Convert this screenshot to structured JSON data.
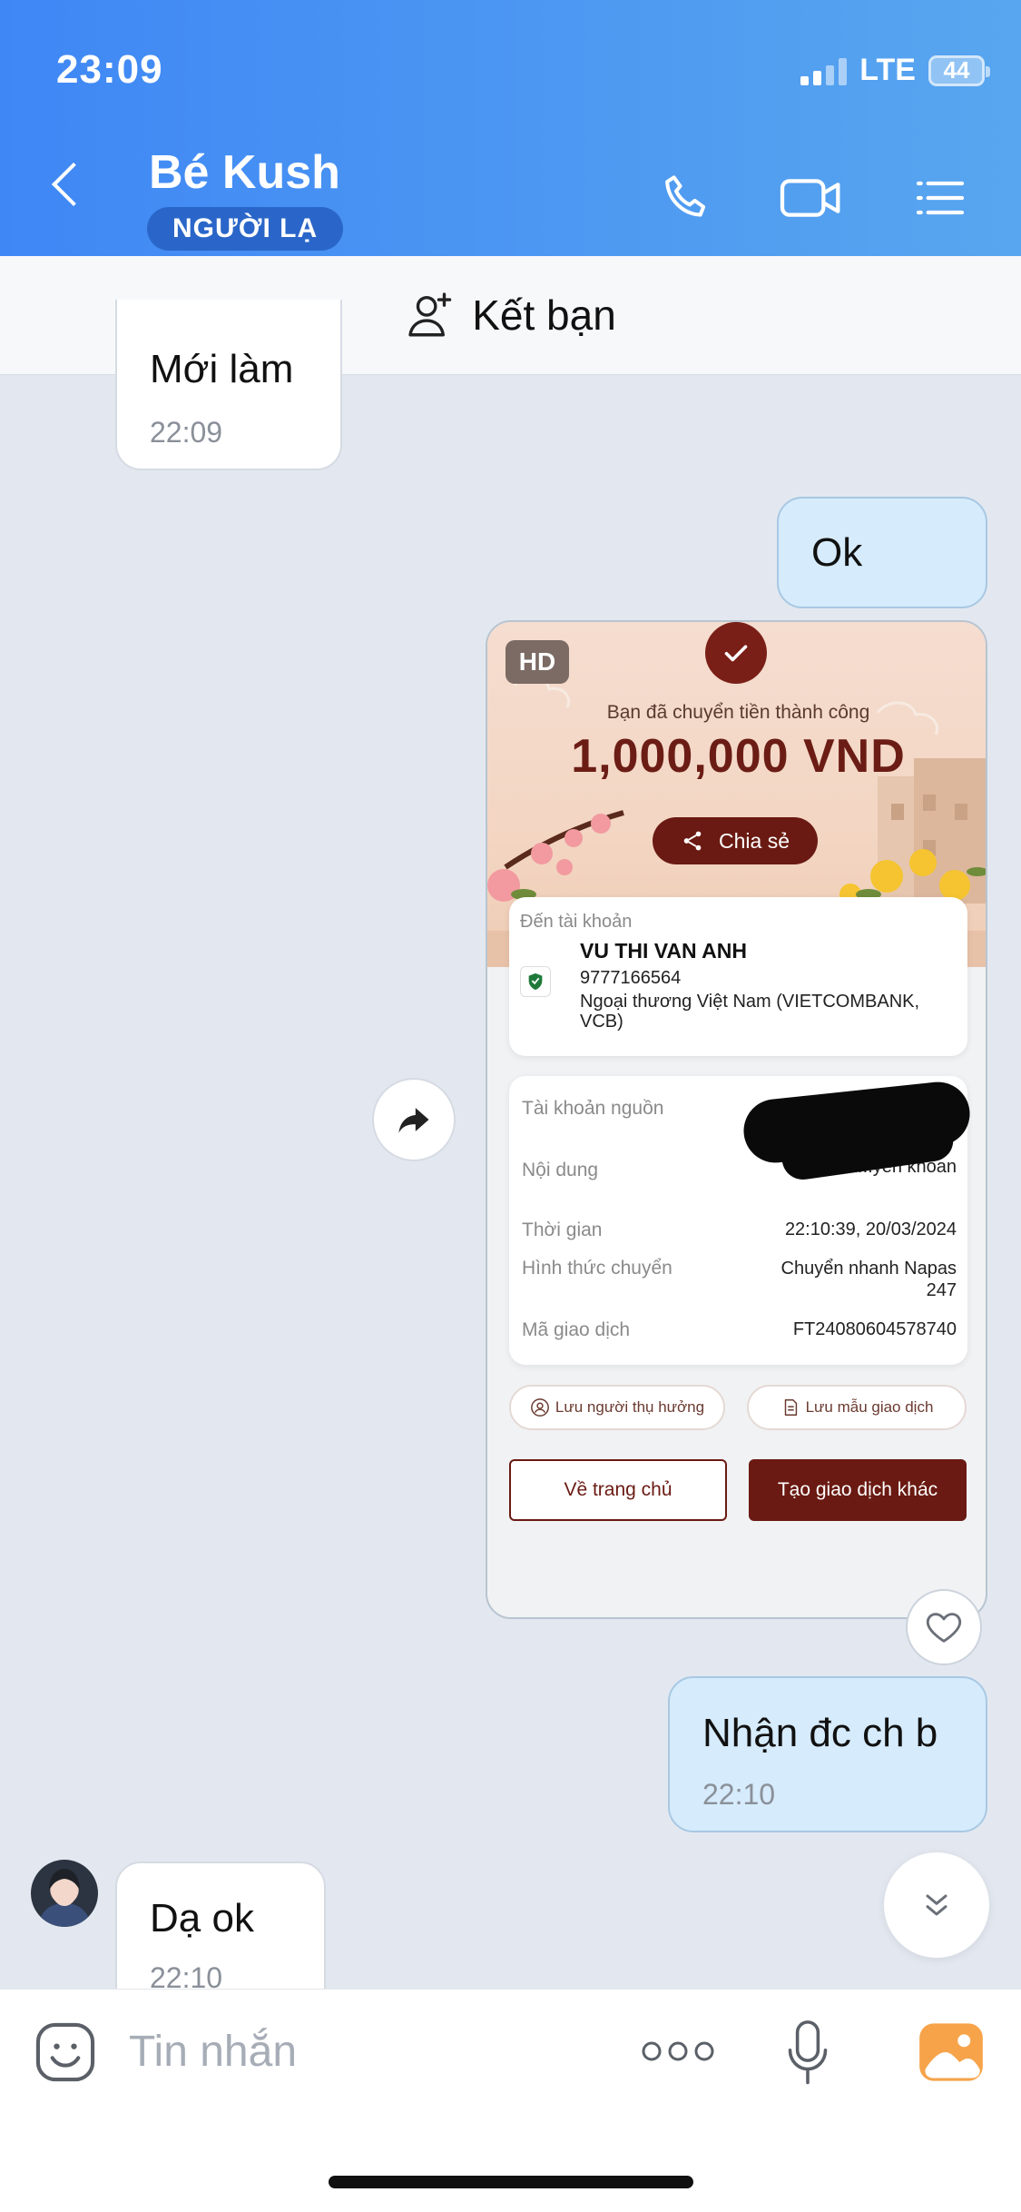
{
  "status_bar": {
    "time": "23:09",
    "network": "LTE",
    "battery": "44"
  },
  "header": {
    "contact_name": "Bé Kush",
    "relationship_badge": "NGƯỜI LẠ",
    "icons": [
      "back-chevron-icon",
      "phone-icon",
      "video-call-icon",
      "menu-list-icon"
    ]
  },
  "add_friend": {
    "label": "Kết bạn",
    "icon": "add-user-icon"
  },
  "messages": [
    {
      "direction": "incoming",
      "text": "Mới làm",
      "time": "22:09"
    },
    {
      "direction": "outgoing",
      "text": "Ok"
    },
    {
      "direction": "outgoing",
      "type": "image"
    },
    {
      "direction": "outgoing",
      "text": "Nhận đc ch b",
      "time": "22:10"
    },
    {
      "direction": "incoming",
      "text": "Dạ ok",
      "time": "22:10"
    }
  ],
  "transfer_receipt": {
    "hd_badge": "HD",
    "success_text": "Bạn đã chuyển tiền thành công",
    "amount": "1,000,000 VND",
    "share_label": "Chia sẻ",
    "to_account_label": "Đến tài khoản",
    "recipient_name": "VU THI VAN ANH",
    "account_number": "9777166564",
    "bank_name": "Ngoại thương Việt Nam (VIETCOMBANK, VCB)",
    "details": [
      {
        "label": "Tài khoản nguồn",
        "value": ""
      },
      {
        "label": "Nội dung",
        "value": "...yen khoan"
      },
      {
        "label": "Thời gian",
        "value": "22:10:39, 20/03/2024"
      },
      {
        "label": "Hình thức chuyển",
        "value": "Chuyển nhanh Napas 247"
      },
      {
        "label": "Mã giao dịch",
        "value": "FT24080604578740"
      }
    ],
    "save_beneficiary": "Lưu người thụ hưởng",
    "save_template": "Lưu mẫu giao dịch",
    "home_button": "Về trang chủ",
    "new_transaction_button": "Tạo giao dịch khác"
  },
  "input_bar": {
    "placeholder": "Tin nhắn",
    "icons": [
      "sticker-icon",
      "more-dots-icon",
      "microphone-icon",
      "image-gallery-icon"
    ]
  },
  "colors": {
    "header_blue": "#4a90f0",
    "outgoing_bubble": "#d6ebfb",
    "receipt_maroon": "#6a1a12"
  }
}
